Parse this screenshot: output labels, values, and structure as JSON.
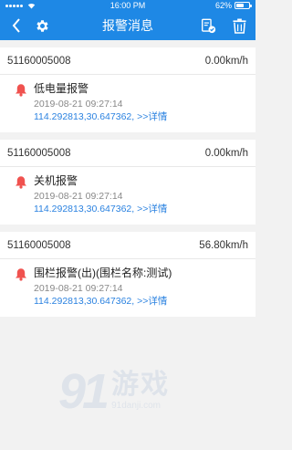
{
  "statusbar": {
    "time": "16:00 PM",
    "battery": "62%",
    "battery_level": 0.62
  },
  "navbar": {
    "title": "报警消息"
  },
  "alarms": [
    {
      "device_id": "51160005008",
      "speed": "0.00km/h",
      "type": "低电量报警",
      "time": "2019-08-21 09:27:14",
      "location": "114.292813,30.647362, >>详情"
    },
    {
      "device_id": "51160005008",
      "speed": "0.00km/h",
      "type": "关机报警",
      "time": "2019-08-21 09:27:14",
      "location": "114.292813,30.647362, >>详情"
    },
    {
      "device_id": "51160005008",
      "speed": "56.80km/h",
      "type": "围栏报警(出)(围栏名称:测试)",
      "time": "2019-08-21 09:27:14",
      "location": "114.292813,30.647362, >>详情"
    }
  ],
  "watermark": {
    "digits": "91",
    "name": "游戏",
    "url": "91danji.com"
  },
  "colors": {
    "accent": "#1e88e5",
    "bell": "#f0524f",
    "link": "#2b82e0"
  }
}
